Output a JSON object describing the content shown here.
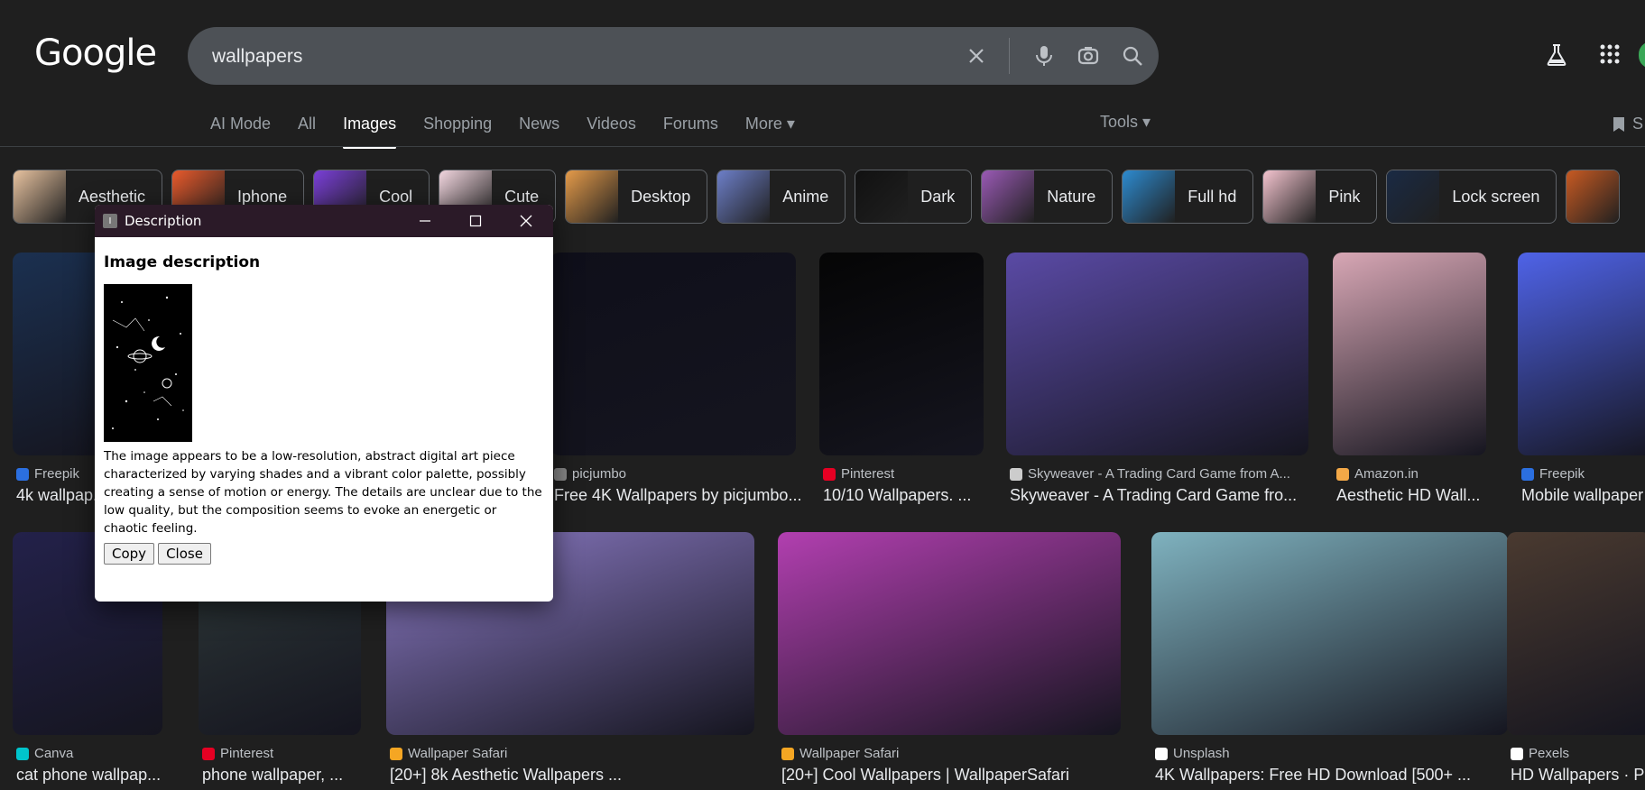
{
  "header": {
    "logo": "Google",
    "search_value": "wallpapers",
    "icons": [
      "close-icon",
      "microphone-icon",
      "lens-icon",
      "search-icon",
      "labs-flask-icon",
      "apps-grid-icon"
    ]
  },
  "tabs": [
    {
      "label": "AI Mode"
    },
    {
      "label": "All"
    },
    {
      "label": "Images",
      "active": true
    },
    {
      "label": "Shopping"
    },
    {
      "label": "News"
    },
    {
      "label": "Videos"
    },
    {
      "label": "Forums"
    },
    {
      "label": "More ▾"
    }
  ],
  "tools_label": "Tools ▾",
  "saved_label": "S",
  "chips": [
    {
      "label": "Aesthetic",
      "color": "#e8c3a0"
    },
    {
      "label": "Iphone",
      "color": "#e85a2c"
    },
    {
      "label": "Cool",
      "color": "#7a3fd8"
    },
    {
      "label": "Cute",
      "color": "#f2d6df"
    },
    {
      "label": "Desktop",
      "color": "#e59b4a"
    },
    {
      "label": "Anime",
      "color": "#6d7fc9"
    },
    {
      "label": "Dark",
      "color": "#111111"
    },
    {
      "label": "Nature",
      "color": "#9a5ab5"
    },
    {
      "label": "Full hd",
      "color": "#2d8bd0"
    },
    {
      "label": "Pink",
      "color": "#f4c4cf"
    },
    {
      "label": "Lock screen",
      "color": "#1a2a44"
    },
    {
      "label": "",
      "color": "#c85a22"
    }
  ],
  "results_row1": [
    {
      "source": "Freepik",
      "title": "4k wallpap...",
      "fav": "#2b6fe0",
      "img": "#1b3050"
    },
    {
      "source": "picjumbo",
      "title": "Free 4K Wallpapers by picjumbo...",
      "fav": "#888888",
      "img": "#0f0f1a"
    },
    {
      "source": "Pinterest",
      "title": "10/10 Wallpapers. ...",
      "fav": "#e60023",
      "img": "#050505"
    },
    {
      "source": "Skyweaver - A Trading Card Game from A...",
      "title": "Skyweaver - A Trading Card Game fro...",
      "fav": "#cccccc",
      "img": "#5a4aa5"
    },
    {
      "source": "Amazon.in",
      "title": "Aesthetic HD Wall...",
      "fav": "#f3a847",
      "img": "#d8a7b5"
    },
    {
      "source": "Freepik",
      "title": "Mobile wallpaper",
      "fav": "#2b6fe0",
      "img": "#4f63e8"
    }
  ],
  "results_row2": [
    {
      "source": "Canva",
      "title": "cat phone wallpap...",
      "fav": "#00c4cc",
      "img": "#23214a"
    },
    {
      "source": "Pinterest",
      "title": "phone wallpaper, ...",
      "fav": "#e60023",
      "img": "#2f3a3a"
    },
    {
      "source": "Wallpaper Safari",
      "title": "[20+] 8k Aesthetic Wallpapers ...",
      "fav": "#f5a623",
      "img": "#8c7bc6"
    },
    {
      "source": "Wallpaper Safari",
      "title": "[20+] Cool Wallpapers | WallpaperSafari",
      "fav": "#f5a623",
      "img": "#b23fb0"
    },
    {
      "source": "Unsplash",
      "title": "4K Wallpapers: Free HD Download [500+ ...",
      "fav": "#ffffff",
      "img": "#7fb2bf"
    },
    {
      "source": "Pexels",
      "title": "HD Wallpapers · P",
      "fav": "#ffffff",
      "img": "#4a3a30"
    }
  ],
  "dialog": {
    "window_title": "Description",
    "heading": "Image description",
    "text": "The image appears to be a low-resolution, abstract digital art piece characterized by varying shades and a vibrant color palette, possibly creating a sense of motion or energy. The details are unclear due to the low quality, but the composition seems to evoke an energetic or chaotic feeling.",
    "copy_label": "Copy",
    "close_label": "Close"
  }
}
